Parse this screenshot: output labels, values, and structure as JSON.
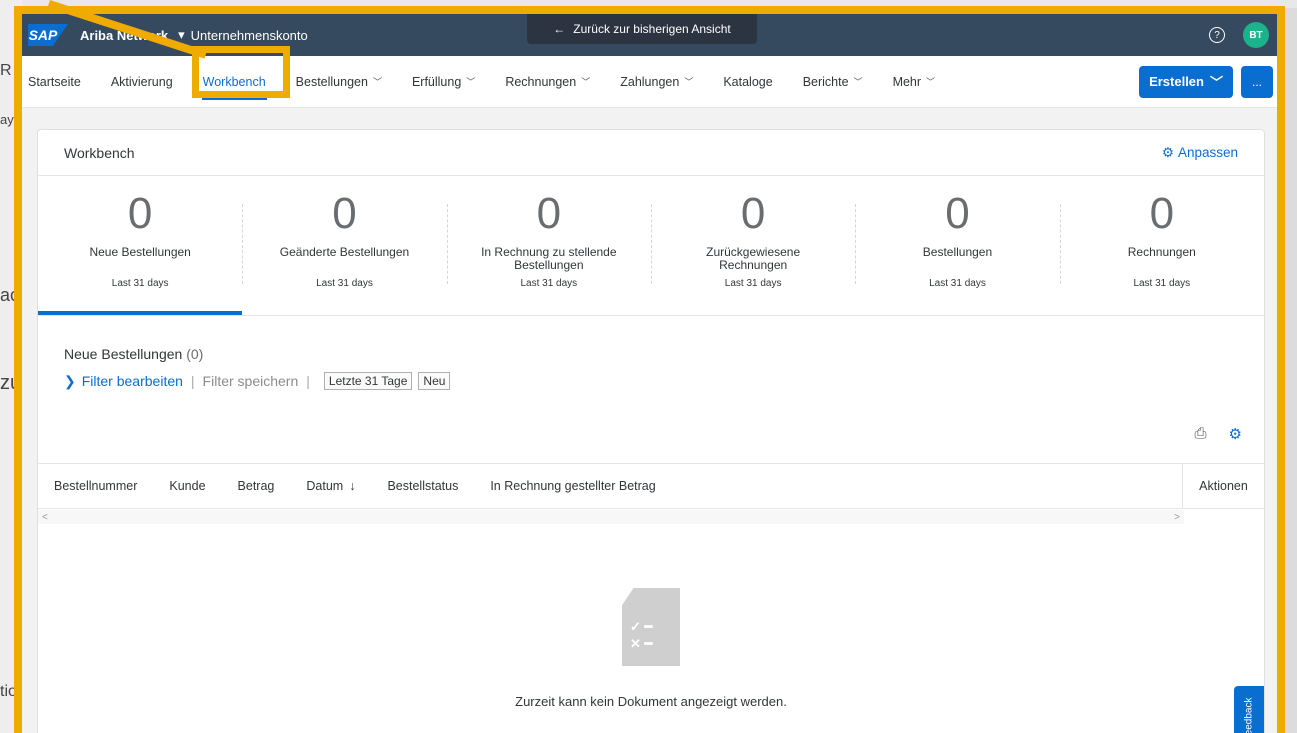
{
  "shell": {
    "product": "Ariba Network",
    "account": "Unternehmenskonto",
    "back_label": "Zurück zur bisherigen Ansicht",
    "avatar_initials": "BT"
  },
  "nav": {
    "items": [
      {
        "label": "Startseite",
        "dropdown": false
      },
      {
        "label": "Aktivierung",
        "dropdown": false
      },
      {
        "label": "Workbench",
        "dropdown": false
      },
      {
        "label": "Bestellungen",
        "dropdown": true
      },
      {
        "label": "Erfüllung",
        "dropdown": true
      },
      {
        "label": "Rechnungen",
        "dropdown": true
      },
      {
        "label": "Zahlungen",
        "dropdown": true
      },
      {
        "label": "Kataloge",
        "dropdown": false
      },
      {
        "label": "Berichte",
        "dropdown": true
      },
      {
        "label": "Mehr",
        "dropdown": true
      }
    ],
    "active": "Workbench",
    "create_label": "Erstellen",
    "more_label": "..."
  },
  "workbench": {
    "title": "Workbench",
    "adjust_label": "Anpassen",
    "tiles": [
      {
        "count": "0",
        "label": "Neue Bestellungen",
        "period": "Last 31 days"
      },
      {
        "count": "0",
        "label": "Geänderte Bestellungen",
        "period": "Last 31 days"
      },
      {
        "count": "0",
        "label": "In Rechnung zu stellende Bestellungen",
        "period": "Last 31 days"
      },
      {
        "count": "0",
        "label": "Zurückgewiesene Rechnungen",
        "period": "Last 31 days"
      },
      {
        "count": "0",
        "label": "Bestellungen",
        "period": "Last 31 days"
      },
      {
        "count": "0",
        "label": "Rechnungen",
        "period": "Last 31 days"
      }
    ]
  },
  "list": {
    "title": "Neue Bestellungen",
    "count": "(0)",
    "filter_edit": "Filter bearbeiten",
    "filter_save": "Filter speichern",
    "tags": [
      "Letzte 31 Tage",
      "Neu"
    ],
    "columns": [
      "Bestellnummer",
      "Kunde",
      "Betrag",
      "Datum",
      "Bestellstatus",
      "In Rechnung gestellter Betrag"
    ],
    "actions_label": "Aktionen",
    "empty_text": "Zurzeit kann kein Dokument angezeigt werden."
  },
  "feedback_label": "Feedback",
  "background_fragments": [
    "R",
    "ay",
    "ac",
    "zu",
    "tio"
  ],
  "colors": {
    "accent": "#0a6ed1",
    "highlight": "#f0ab00",
    "shell": "#354a5f",
    "avatar": "#1bb38b"
  }
}
